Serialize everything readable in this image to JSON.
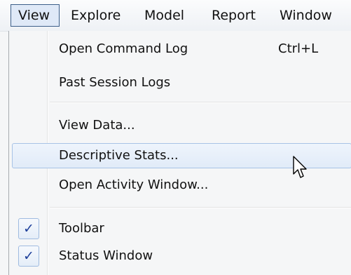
{
  "menubar": {
    "items": [
      {
        "label": "View",
        "selected": true
      },
      {
        "label": "Explore"
      },
      {
        "label": "Model"
      },
      {
        "label": "Report"
      },
      {
        "label": "Window"
      }
    ]
  },
  "menu": {
    "open_command_log": {
      "label": "Open Command Log",
      "shortcut": "Ctrl+L"
    },
    "past_session_logs": {
      "label": "Past Session Logs"
    },
    "view_data": {
      "label": "View Data..."
    },
    "descriptive_stats": {
      "label": "Descriptive Stats..."
    },
    "open_activity_window": {
      "label": "Open Activity Window..."
    },
    "toolbar": {
      "label": "Toolbar",
      "checked": true,
      "check_glyph": "✓"
    },
    "status_window": {
      "label": "Status Window",
      "checked": true,
      "check_glyph": "✓"
    }
  },
  "cursor": {
    "icon": "mouse-pointer-icon"
  }
}
